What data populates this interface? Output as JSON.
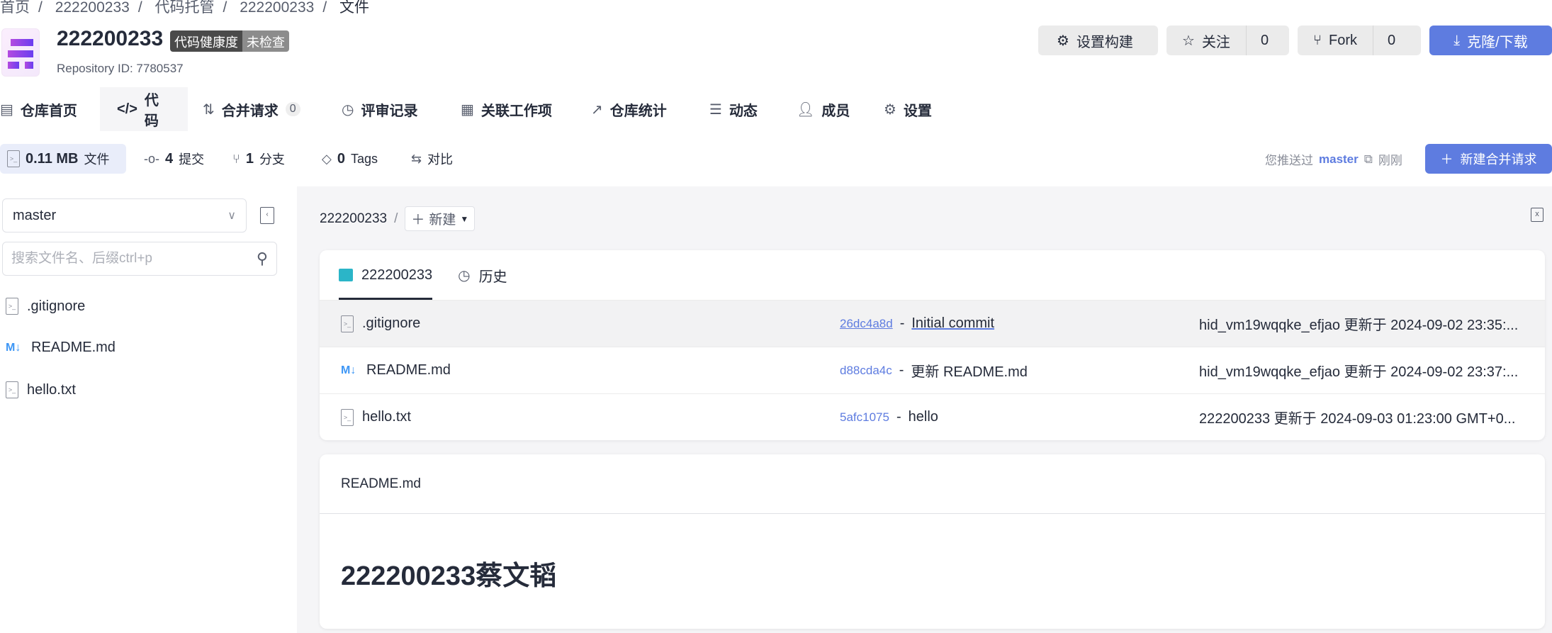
{
  "breadcrumb": [
    "首页",
    "222200233",
    "代码托管",
    "222200233",
    "文件"
  ],
  "repo": {
    "name": "222200233",
    "health_label": "代码健康度",
    "health_status": "未检查",
    "repository_id": "Repository ID: 7780537"
  },
  "actions": {
    "settings_build": "设置构建",
    "watch": "关注",
    "watch_count": "0",
    "fork": "Fork",
    "fork_count": "0",
    "clone": "克隆/下载"
  },
  "tabs": [
    {
      "label": "仓库首页"
    },
    {
      "label": "代码"
    },
    {
      "label": "合并请求",
      "count": "0"
    },
    {
      "label": "评审记录"
    },
    {
      "label": "关联工作项"
    },
    {
      "label": "仓库统计"
    },
    {
      "label": "动态"
    },
    {
      "label": "成员"
    },
    {
      "label": "设置"
    }
  ],
  "stats": {
    "size": "0.11 MB",
    "size_label": "文件",
    "commits": "4",
    "commits_label": "提交",
    "branches": "1",
    "branches_label": "分支",
    "tags": "0",
    "tags_label": "Tags",
    "compare": "对比"
  },
  "push": {
    "prefix": "您推送过",
    "branch": "master",
    "time": "刚刚"
  },
  "new_mr": "新建合并请求",
  "sidebar": {
    "branch": "master",
    "search_placeholder": "搜索文件名、后缀ctrl+p",
    "files": [
      ".gitignore",
      "README.md",
      "hello.txt"
    ]
  },
  "path": {
    "root": "222200233",
    "sep": "/",
    "new": "新建"
  },
  "card": {
    "tab_repo": "222200233",
    "tab_history": "历史",
    "rows": [
      {
        "name": ".gitignore",
        "hash": "26dc4a8d",
        "message": "Initial commit",
        "info": "hid_vm19wqqke_efjao 更新于 2024-09-02 23:35:..."
      },
      {
        "name": "README.md",
        "hash": "d88cda4c",
        "message": "更新 README.md",
        "info": "hid_vm19wqqke_efjao 更新于 2024-09-02 23:37:..."
      },
      {
        "name": "hello.txt",
        "hash": "5afc1075",
        "message": "hello",
        "info": "222200233 更新于 2024-09-03 01:23:00 GMT+0..."
      }
    ]
  },
  "readme": {
    "file": "README.md",
    "heading": "222200233蔡文韬"
  },
  "colors": {
    "primary": "#5e7ce0",
    "folder": "#2bb5c8",
    "markdown": "#3d96f5"
  }
}
